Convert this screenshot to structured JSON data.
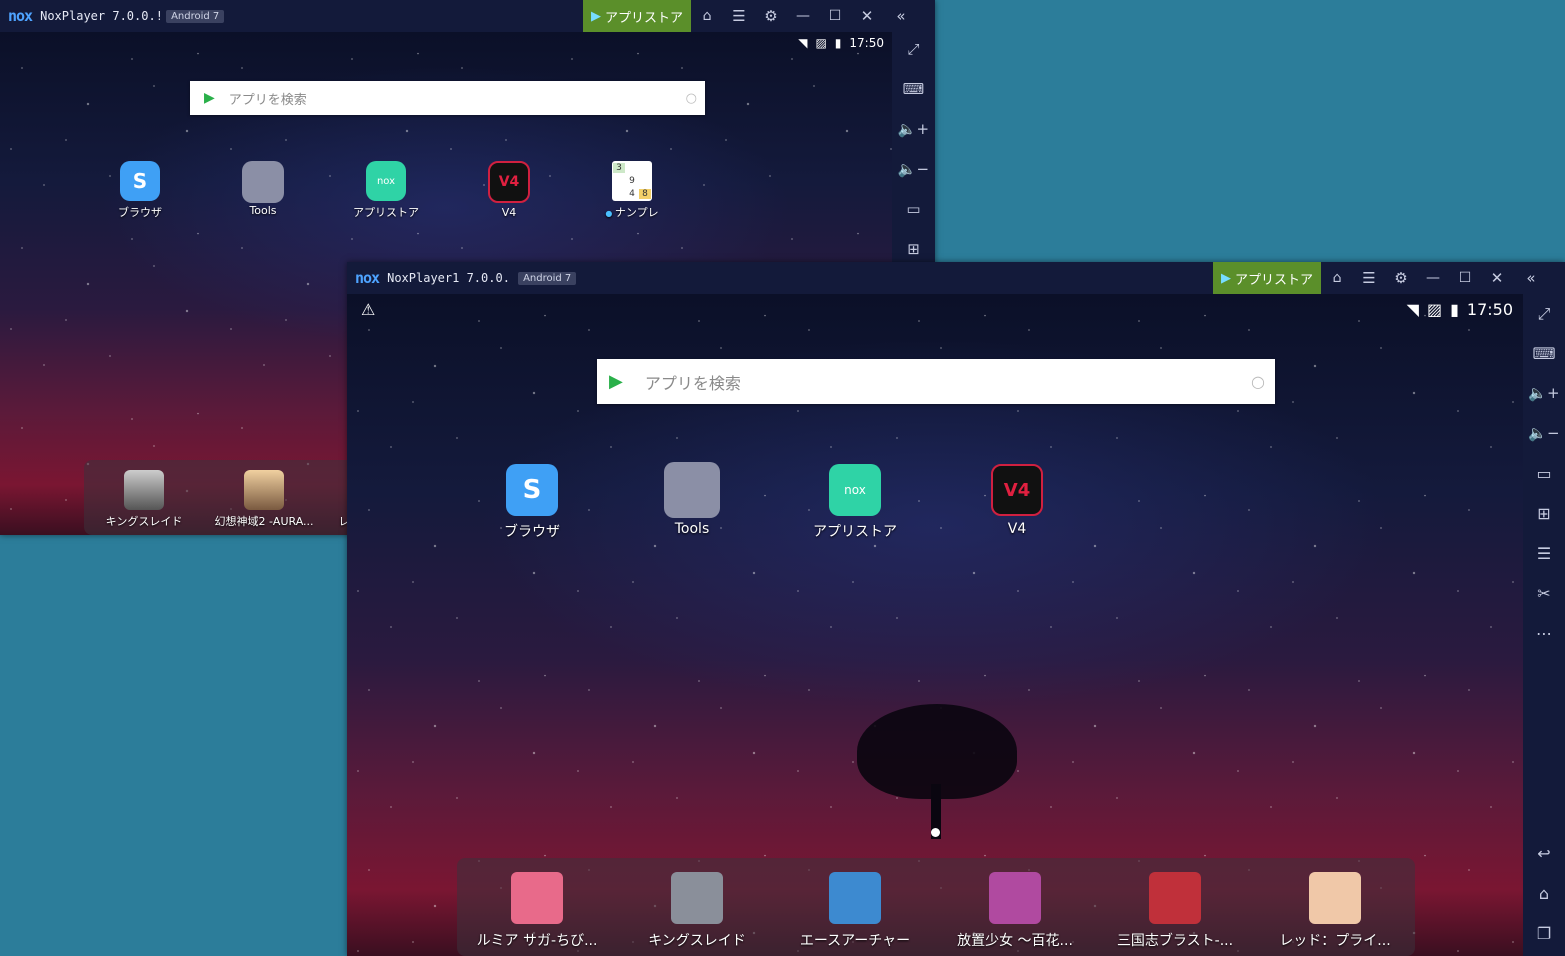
{
  "back_window": {
    "logo": "nox",
    "title": "NoxPlayer 7.0.0.!",
    "android_badge": "Android 7",
    "store_button": "アプリストア",
    "time": "17:50",
    "search_placeholder": "アプリを検索",
    "apps": [
      {
        "label": "ブラウザ",
        "icon": "browser-icon"
      },
      {
        "label": "Tools",
        "icon": "tools-folder-icon"
      },
      {
        "label": "アプリストア",
        "icon": "app-store-icon"
      },
      {
        "label": "V4",
        "icon": "v4-game-icon"
      },
      {
        "label": "ナンプレ",
        "icon": "sudoku-icon"
      }
    ],
    "sudoku_digits": [
      "3",
      "9",
      "4",
      "8"
    ],
    "dock": [
      {
        "label": "キングスレイド"
      },
      {
        "label": "幻想神域2 -AURA..."
      },
      {
        "label": "レ"
      }
    ]
  },
  "front_window": {
    "logo": "nox",
    "title": "NoxPlayer1 7.0.0.!",
    "android_badge": "Android 7",
    "store_button": "アプリストア",
    "time": "17:50",
    "search_placeholder": "アプリを検索",
    "apps": [
      {
        "label": "ブラウザ",
        "icon": "browser-icon"
      },
      {
        "label": "Tools",
        "icon": "tools-folder-icon"
      },
      {
        "label": "アプリストア",
        "icon": "app-store-icon"
      },
      {
        "label": "V4",
        "icon": "v4-game-icon"
      }
    ],
    "dock": [
      {
        "label": "ルミア サガ-ちび...",
        "color": "#e86a8a"
      },
      {
        "label": "キングスレイド",
        "color": "#8a8f9a"
      },
      {
        "label": "エースアーチャー",
        "color": "#3d8ad0"
      },
      {
        "label": "放置少女 〜百花...",
        "color": "#b04aa0"
      },
      {
        "label": "三国志ブラスト-...",
        "color": "#c0303a"
      },
      {
        "label": "レッド：プライ...",
        "color": "#f0c8a8"
      }
    ],
    "app_icon_text": {
      "browser": "S",
      "store": "nox",
      "v4": "V4"
    }
  },
  "colors": {
    "desktop": "#2c7d9a",
    "titlebar": "#131a3a",
    "store_green": "#5b8f2a",
    "app_store_teal": "#2fd3a6",
    "browser_blue": "#3fa0f5"
  }
}
